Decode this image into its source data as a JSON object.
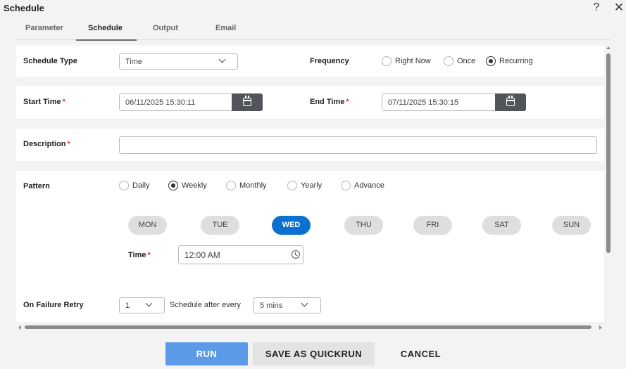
{
  "window": {
    "title": "Schedule",
    "help_glyph": "?",
    "close_glyph": "✕"
  },
  "tabs": [
    {
      "label": "Parameter",
      "active": false
    },
    {
      "label": "Schedule",
      "active": true
    },
    {
      "label": "Output",
      "active": false
    },
    {
      "label": "Email",
      "active": false
    }
  ],
  "schedule_type": {
    "label": "Schedule Type",
    "value": "Time"
  },
  "frequency": {
    "label": "Frequency",
    "options": [
      {
        "label": "Right Now",
        "checked": false
      },
      {
        "label": "Once",
        "checked": false
      },
      {
        "label": "Recurring",
        "checked": true
      }
    ]
  },
  "start_time": {
    "label": "Start Time",
    "required_mark": "*",
    "value": "06/11/2025 15:30:11"
  },
  "end_time": {
    "label": "End Time",
    "required_mark": "*",
    "value": "07/11/2025 15:30:15"
  },
  "description": {
    "label": "Description",
    "required_mark": "*",
    "value": ""
  },
  "pattern": {
    "label": "Pattern",
    "options": [
      {
        "label": "Daily",
        "checked": false
      },
      {
        "label": "Weekly",
        "checked": true
      },
      {
        "label": "Monthly",
        "checked": false
      },
      {
        "label": "Yearly",
        "checked": false
      },
      {
        "label": "Advance",
        "checked": false
      }
    ],
    "days": [
      {
        "label": "MON",
        "selected": false
      },
      {
        "label": "TUE",
        "selected": false
      },
      {
        "label": "WED",
        "selected": true
      },
      {
        "label": "THU",
        "selected": false
      },
      {
        "label": "FRI",
        "selected": false
      },
      {
        "label": "SAT",
        "selected": false
      },
      {
        "label": "SUN",
        "selected": false
      }
    ],
    "time": {
      "label": "Time",
      "required_mark": "*",
      "value": "12:00 AM"
    }
  },
  "retry": {
    "label": "On Failure Retry",
    "count_value": "1",
    "after_label": "Schedule after every",
    "interval_value": "5 mins"
  },
  "footer": {
    "run_label": "RUN",
    "quickrun_label": "SAVE AS QUICKRUN",
    "cancel_label": "CANCEL"
  },
  "colors": {
    "accent": "#0a71d1",
    "run_button": "#5b9ae6",
    "dark_button": "#515459",
    "required": "#d33333"
  },
  "icons": {
    "calendar": "calendar-icon",
    "clock": "clock-icon",
    "chevron": "chevron-down-icon"
  }
}
